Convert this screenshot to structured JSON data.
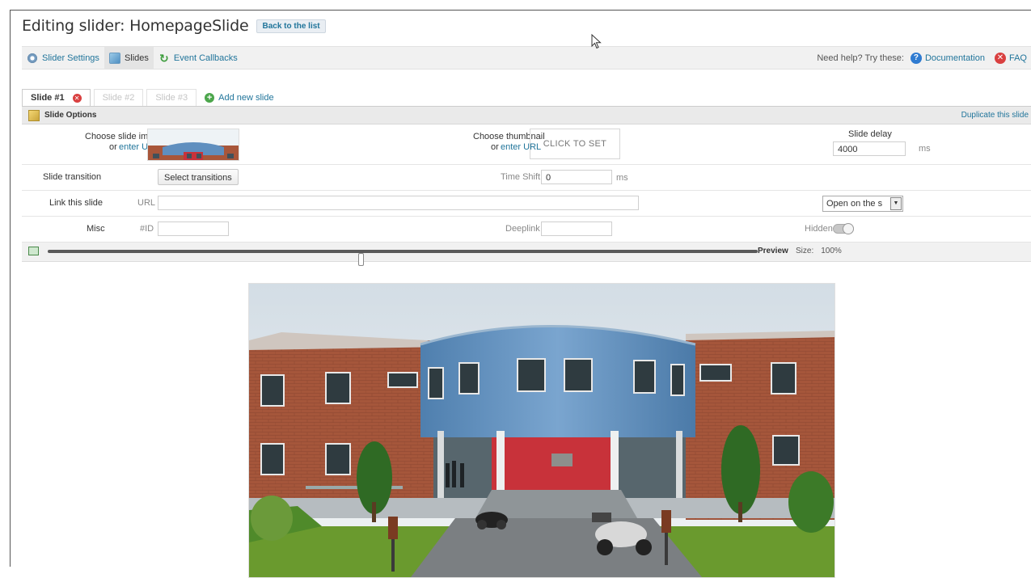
{
  "header": {
    "title": "Editing slider: HomepageSlide",
    "back_label": "Back to the list"
  },
  "toolbar": {
    "tabs": [
      {
        "label": "Slider Settings",
        "icon": "gear-icon"
      },
      {
        "label": "Slides",
        "icon": "slides-icon"
      },
      {
        "label": "Event Callbacks",
        "icon": "callback-icon"
      }
    ],
    "help_text": "Need help? Try these:",
    "documentation_label": "Documentation",
    "faq_label": "FAQ"
  },
  "slide_tabs": {
    "tabs": [
      "Slide #1",
      "Slide #2",
      "Slide #3"
    ],
    "active_index": 0,
    "add_label": "Add new slide"
  },
  "slide_options": {
    "header": "Slide Options",
    "duplicate_label": "Duplicate this slide",
    "row1": {
      "choose_image": "Choose slide image",
      "enter_url_prefix": "or",
      "enter_url": "enter URL",
      "choose_thumbnail": "Choose thumbnail",
      "thumb_enter_url": "enter URL",
      "click_to_set": "CLICK TO SET",
      "slide_delay_label": "Slide delay",
      "slide_delay_value": "4000",
      "slide_delay_unit": "ms"
    },
    "row2": {
      "transition_label": "Slide transition",
      "transition_button": "Select transitions",
      "time_shift_label": "Time Shift",
      "time_shift_value": "0",
      "time_shift_unit": "ms"
    },
    "row3": {
      "link_label": "Link this slide",
      "url_label": "URL",
      "url_value": "",
      "target_value": "Open on the s"
    },
    "row4": {
      "misc_label": "Misc",
      "id_label": "#ID",
      "id_value": "",
      "deeplink_label": "Deeplink",
      "deeplink_value": "",
      "hidden_label": "Hidden"
    }
  },
  "preview": {
    "label": "Preview",
    "size_label": "Size:",
    "size_value": "100%",
    "zoom_fraction": 0.44
  },
  "colors": {
    "link": "#21759b",
    "toolbar_bg": "#f1f1f1",
    "brick": "#a8563a",
    "blue_facade": "#5f8fbf",
    "red_wall": "#c8323a",
    "grass": "#6a9a2e",
    "sky": "#e6edf2"
  }
}
